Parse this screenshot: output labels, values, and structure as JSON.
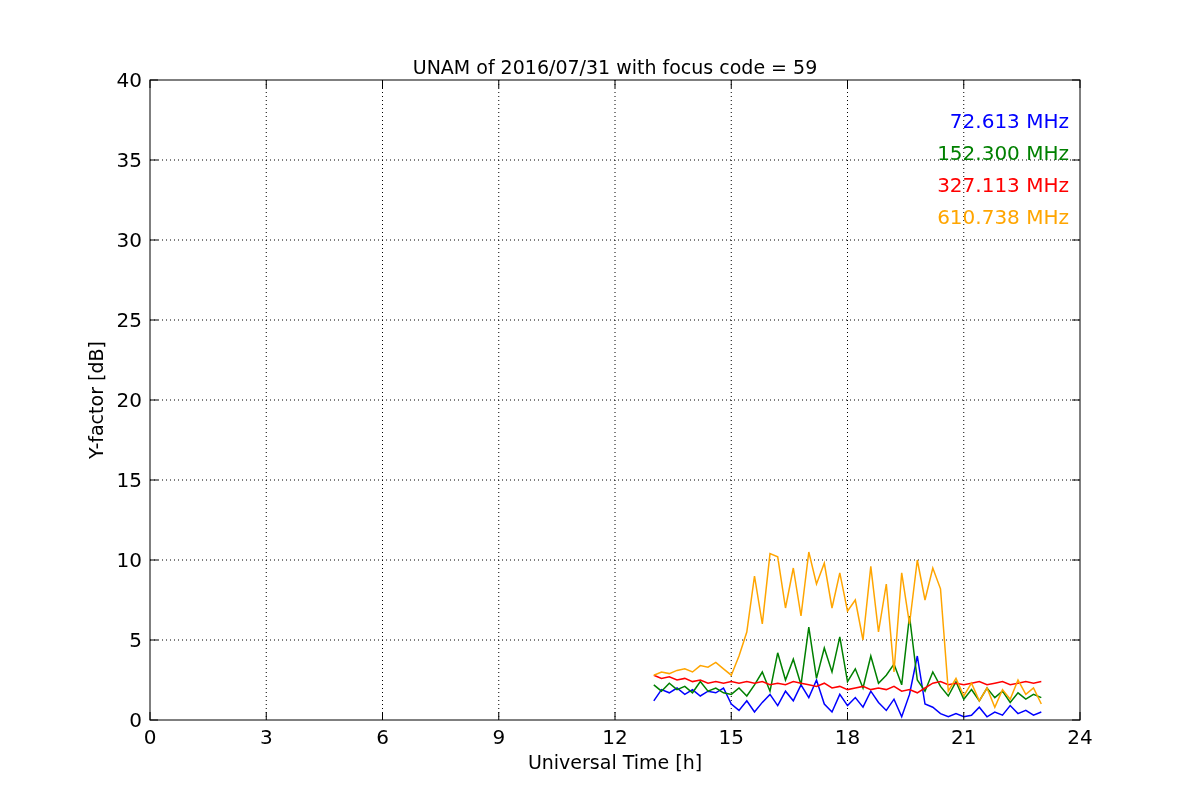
{
  "chart_data": {
    "type": "line",
    "title": "UNAM of 2016/07/31 with focus code = 59",
    "xlabel": "Universal Time [h]",
    "ylabel": "Y-factor [dB]",
    "grid": true,
    "xlim": [
      0,
      24
    ],
    "ylim": [
      0,
      40
    ],
    "xticks": [
      0,
      3,
      6,
      9,
      12,
      15,
      18,
      21,
      24
    ],
    "yticks": [
      0,
      5,
      10,
      15,
      20,
      25,
      30,
      35,
      40
    ],
    "x": [
      13,
      13.2,
      13.4,
      13.6,
      13.8,
      14,
      14.2,
      14.4,
      14.6,
      14.8,
      15,
      15.2,
      15.4,
      15.6,
      15.8,
      16,
      16.2,
      16.4,
      16.6,
      16.8,
      17,
      17.2,
      17.4,
      17.6,
      17.8,
      18,
      18.2,
      18.4,
      18.6,
      18.8,
      19,
      19.2,
      19.4,
      19.6,
      19.8,
      20,
      20.2,
      20.4,
      20.6,
      20.8,
      21,
      21.2,
      21.4,
      21.6,
      21.8,
      22,
      22.2,
      22.4,
      22.6,
      22.8,
      23
    ],
    "series": [
      {
        "name": "72.613 MHz",
        "color": "#0000ff",
        "values": [
          1.2,
          1.9,
          1.7,
          2.0,
          1.6,
          1.9,
          1.5,
          1.8,
          1.7,
          2.0,
          1.0,
          0.6,
          1.2,
          0.5,
          1.1,
          1.6,
          0.9,
          1.8,
          1.2,
          2.2,
          1.4,
          2.5,
          1.0,
          0.5,
          1.6,
          0.9,
          1.4,
          0.8,
          1.8,
          1.1,
          0.6,
          1.3,
          0.2,
          1.6,
          4.0,
          1.0,
          0.8,
          0.4,
          0.2,
          0.4,
          0.2,
          0.3,
          0.8,
          0.2,
          0.5,
          0.3,
          0.9,
          0.4,
          0.6,
          0.3,
          0.5
        ]
      },
      {
        "name": "152.300 MHz",
        "color": "#008000",
        "values": [
          2.2,
          1.8,
          2.3,
          1.9,
          2.1,
          1.7,
          2.4,
          1.8,
          2.0,
          1.7,
          1.6,
          2.0,
          1.5,
          2.2,
          3.0,
          1.8,
          4.2,
          2.5,
          3.8,
          2.2,
          5.8,
          2.6,
          4.5,
          3.0,
          5.2,
          2.4,
          3.2,
          2.0,
          4.0,
          2.3,
          2.8,
          3.5,
          2.2,
          6.5,
          2.5,
          1.8,
          3.0,
          2.1,
          1.5,
          2.4,
          1.3,
          1.9,
          1.2,
          2.0,
          1.4,
          1.8,
          1.1,
          1.7,
          1.3,
          1.6,
          1.4
        ]
      },
      {
        "name": "327.113 MHz",
        "color": "#ff0000",
        "values": [
          2.8,
          2.6,
          2.7,
          2.5,
          2.6,
          2.4,
          2.5,
          2.3,
          2.4,
          2.3,
          2.4,
          2.3,
          2.4,
          2.3,
          2.4,
          2.2,
          2.3,
          2.2,
          2.4,
          2.3,
          2.2,
          2.1,
          2.3,
          2.0,
          2.1,
          1.9,
          2.0,
          2.1,
          1.9,
          2.0,
          1.9,
          2.1,
          1.8,
          1.9,
          1.7,
          2.0,
          2.3,
          2.4,
          2.2,
          2.3,
          2.2,
          2.3,
          2.4,
          2.2,
          2.3,
          2.4,
          2.2,
          2.3,
          2.4,
          2.3,
          2.4
        ]
      },
      {
        "name": "610.738 MHz",
        "color": "#ffa500",
        "values": [
          2.8,
          3.0,
          2.9,
          3.1,
          3.2,
          3.0,
          3.4,
          3.3,
          3.6,
          3.2,
          2.8,
          4.0,
          5.5,
          9.0,
          6.0,
          10.4,
          10.2,
          7.0,
          9.5,
          6.5,
          10.5,
          8.5,
          9.8,
          7.0,
          9.2,
          6.8,
          7.5,
          5.0,
          9.6,
          5.5,
          8.5,
          3.0,
          9.2,
          6.0,
          10.0,
          7.5,
          9.5,
          8.2,
          1.8,
          2.6,
          1.5,
          2.3,
          1.2,
          2.0,
          0.8,
          1.9,
          1.3,
          2.5,
          1.6,
          2.0,
          1.0
        ]
      }
    ]
  }
}
